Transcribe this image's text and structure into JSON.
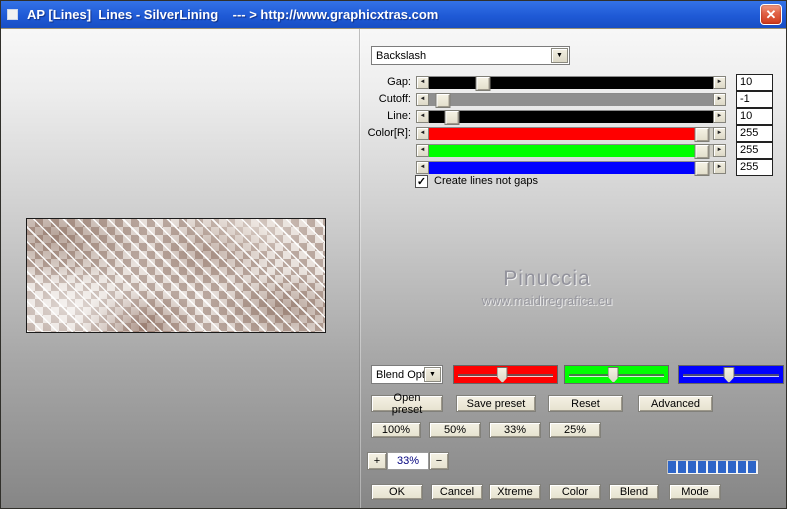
{
  "window": {
    "title": "AP [Lines]  Lines - SilverLining    --- > http://www.graphicxtras.com"
  },
  "icons": {
    "close": "✕",
    "dropdown_arrow": "▼",
    "left_arrow": "◄",
    "right_arrow": "►",
    "check": "✓"
  },
  "preset_dropdown": {
    "value": "Backslash"
  },
  "sliders": {
    "rows": [
      {
        "label": "Gap:",
        "value": "10",
        "track_color": "#000000",
        "fill_width": "100%",
        "thumb_left": "19%"
      },
      {
        "label": "Cutoff:",
        "value": "-1",
        "track_color": "#8f8f8f",
        "fill_width": "100%",
        "thumb_left": "5%"
      },
      {
        "label": "Line:",
        "value": "10",
        "track_color": "#000000",
        "fill_width": "100%",
        "thumb_left": "8%"
      },
      {
        "label": "Color[R]:",
        "value": "255",
        "track_color": "#ff0000",
        "fill_width": "94%",
        "thumb_left": "96%"
      },
      {
        "label": "",
        "value": "255",
        "track_color": "#00ff00",
        "fill_width": "94%",
        "thumb_left": "96%"
      },
      {
        "label": "",
        "value": "255",
        "track_color": "#0000ff",
        "fill_width": "94%",
        "thumb_left": "96%"
      }
    ]
  },
  "checkbox": {
    "label": "Create lines not gaps",
    "checked": true
  },
  "watermark": {
    "line1": "Pinuccia",
    "line2": "www.maidiregrafica.eu"
  },
  "blend": {
    "dropdown_value": "Blend Opti",
    "sliders": [
      {
        "name": "red",
        "color": "#ff0000",
        "thumb_left": "47%"
      },
      {
        "name": "green",
        "color": "#00ff00",
        "thumb_left": "47%"
      },
      {
        "name": "blue",
        "color": "#0000ff",
        "thumb_left": "48%"
      }
    ]
  },
  "preset_buttons": [
    "Open preset",
    "Save preset",
    "Reset",
    "Advanced"
  ],
  "zoom_buttons": [
    "100%",
    "50%",
    "33%",
    "25%"
  ],
  "zoom_control": {
    "plus": "+",
    "value": "33%",
    "minus": "−"
  },
  "progress": {
    "segments": 9,
    "color": "#2f66c8"
  },
  "action_buttons": [
    "OK",
    "Cancel",
    "Xtreme",
    "Color",
    "Blend",
    "Mode"
  ]
}
